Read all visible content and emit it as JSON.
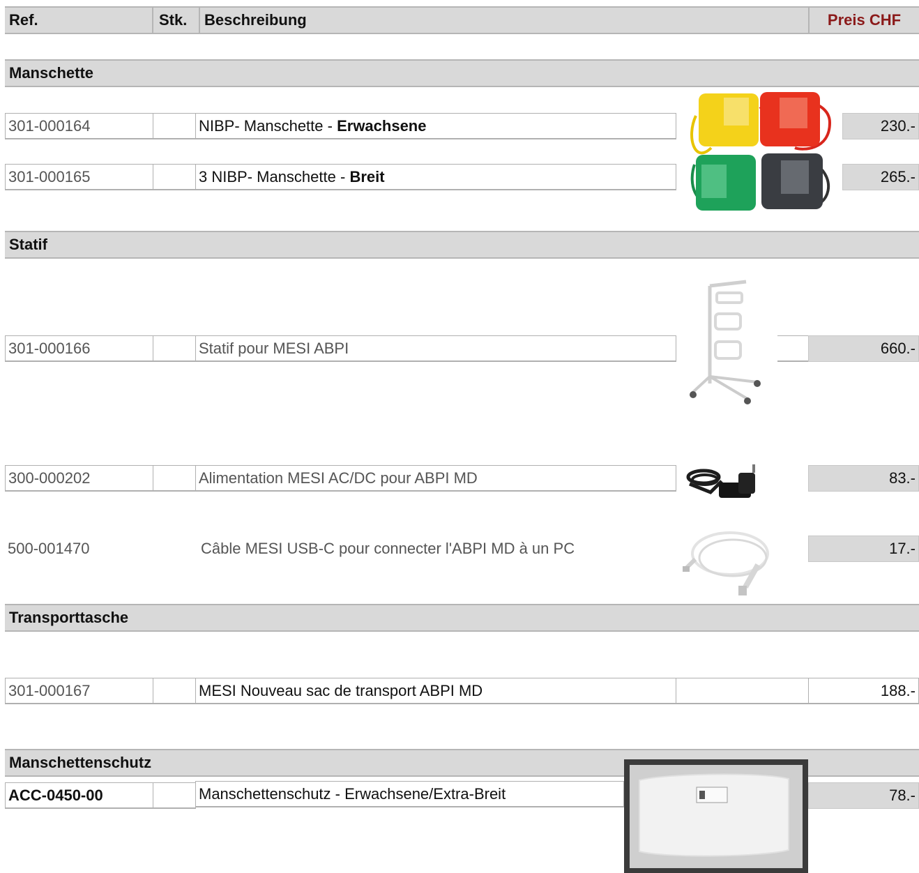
{
  "header": {
    "ref": "Ref.",
    "stk": "Stk.",
    "beschreibung": "Beschreibung",
    "preis": "Preis CHF"
  },
  "sections": {
    "manschette": "Manschette",
    "statif": "Statif",
    "transporttasche": "Transporttasche",
    "manschettenschutz": "Manschettenschutz"
  },
  "rows": [
    {
      "ref": "301-000164",
      "desc_prefix": "NIBP- Manschette - ",
      "desc_bold": "Erwachsene",
      "price": "230.-"
    },
    {
      "ref": "301-000165",
      "desc_prefix": "3 NIBP- Manschette - ",
      "desc_bold": "Breit",
      "price": "265.-"
    },
    {
      "ref": "301-000166",
      "desc": "Statif pour MESI ABPI",
      "price": "660.-"
    },
    {
      "ref": "300-000202",
      "desc": "Alimentation MESI AC/DC pour ABPI MD",
      "price": "83.-"
    },
    {
      "ref": "500-001470",
      "desc": "Câble MESI USB-C pour connecter l'ABPI MD à un PC",
      "price": "17.-"
    },
    {
      "ref": "301-000167",
      "desc": "MESI Nouveau sac de transport ABPI MD",
      "price": "188.-"
    },
    {
      "ref": "ACC-0450-00",
      "desc": "Manschettenschutz - Erwachsene/Extra-Breit",
      "price": "78.-"
    }
  ],
  "images": {
    "cuffs": "cuffs-image",
    "stand": "stand-image",
    "adapter": "power-adapter-image",
    "cable": "usb-cable-image",
    "cover": "cuff-cover-image"
  },
  "colors": {
    "price_header": "#8b1a1a",
    "section_bg": "#d9d9d9"
  }
}
